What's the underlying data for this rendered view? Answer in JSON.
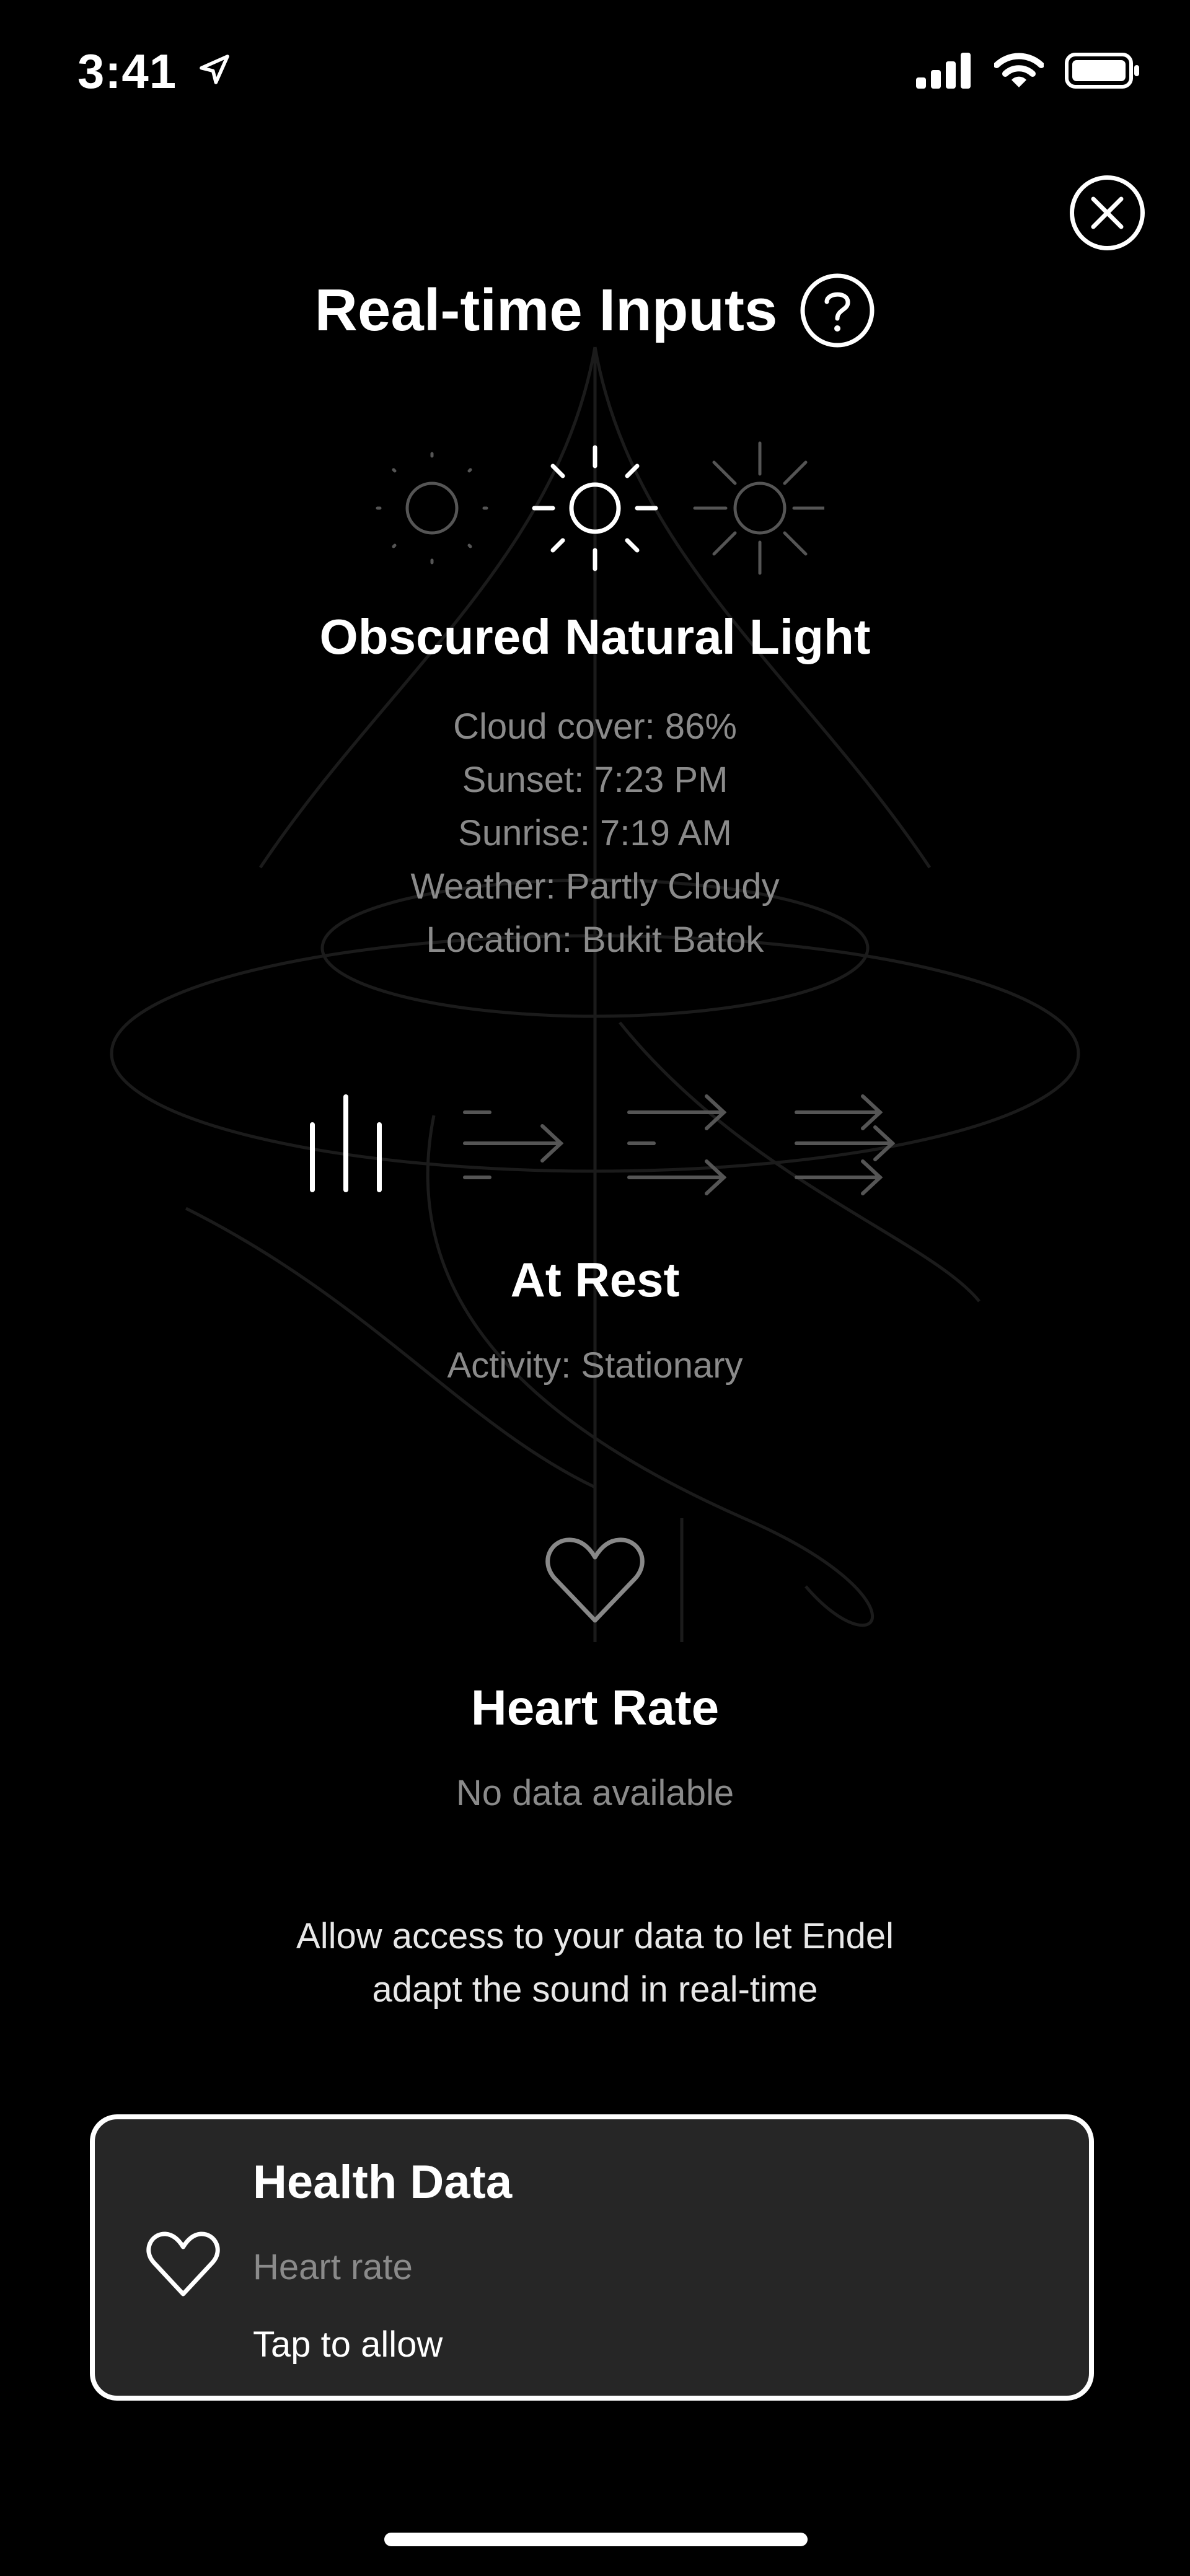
{
  "status_bar": {
    "time": "3:41",
    "icons": [
      "location-arrow-icon",
      "signal-icon",
      "wifi-icon",
      "battery-icon"
    ]
  },
  "header": {
    "title": "Real-time Inputs",
    "help_icon": "question-circle-icon",
    "close_icon": "close-circle-icon"
  },
  "light": {
    "icons": [
      "dim-sun-icon",
      "obscured-sun-icon",
      "bright-sun-icon"
    ],
    "selected_index": 1,
    "title": "Obscured Natural Light",
    "details": [
      "Cloud cover: 86%",
      "Sunset: 7:23 PM",
      "Sunrise: 7:19 AM",
      "Weather: Partly Cloudy",
      "Location: Bukit Batok"
    ]
  },
  "activity": {
    "icons": [
      "rest-bars-icon",
      "walk-arrows-icon",
      "run-arrows-icon",
      "fast-arrows-icon"
    ],
    "selected_index": 0,
    "title": "At Rest",
    "detail": "Activity: Stationary"
  },
  "heart_rate": {
    "icon": "heart-outline-icon",
    "title": "Heart Rate",
    "detail": "No data available"
  },
  "allow_text": {
    "line1": "Allow access to your data to let Endel",
    "line2": "adapt the sound in real-time"
  },
  "health_card": {
    "icon": "heart-outline-icon",
    "title": "Health Data",
    "subtitle": "Heart rate",
    "action": "Tap to allow"
  },
  "colors": {
    "background": "#000000",
    "muted_text": "#8a8a8a",
    "card_background": "#262626"
  }
}
